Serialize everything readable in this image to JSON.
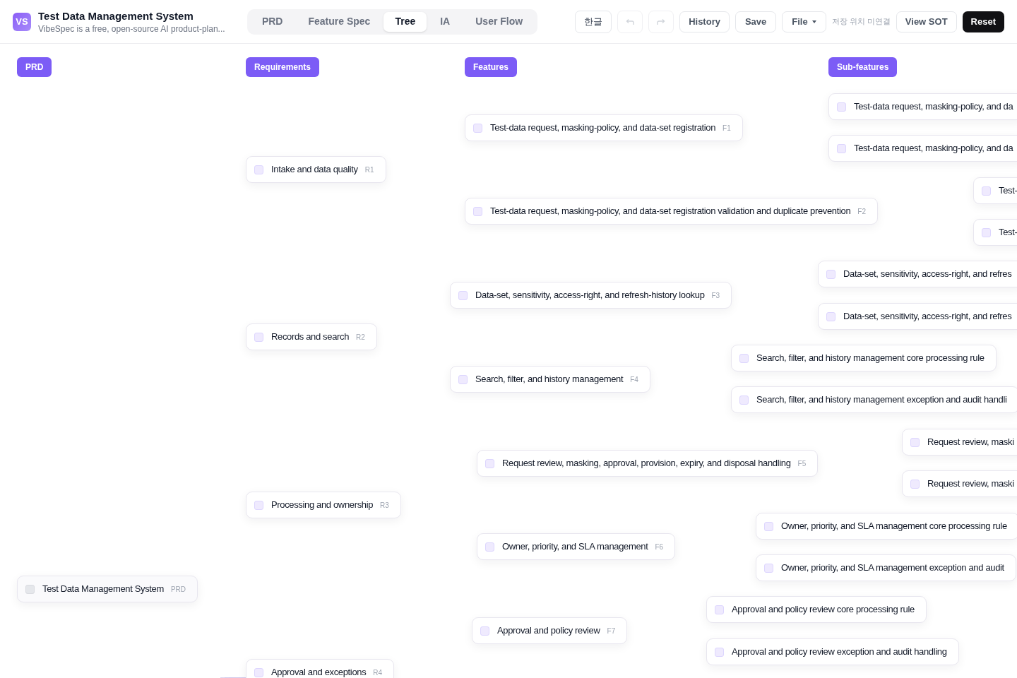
{
  "app": {
    "logo": "VS",
    "title": "Test Data Management System",
    "subtitle": "VibeSpec is a free, open-source AI product-plan..."
  },
  "tabs": [
    {
      "label": "PRD",
      "selected": false
    },
    {
      "label": "Feature Spec",
      "selected": false
    },
    {
      "label": "Tree",
      "selected": true
    },
    {
      "label": "IA",
      "selected": false
    },
    {
      "label": "User Flow",
      "selected": false
    }
  ],
  "toolbar": {
    "language": "한글",
    "undo": {
      "disabled": true
    },
    "redo": {
      "disabled": true
    },
    "history": "History",
    "save": "Save",
    "file": "File",
    "storage_status": "저장 위치 미연결",
    "view_sot": "View SOT",
    "reset": "Reset"
  },
  "columns": [
    "PRD",
    "Requirements",
    "Features",
    "Sub-features"
  ],
  "tree": {
    "label": "Test Data Management System",
    "code": "PRD",
    "kind": "root",
    "checked": false,
    "children": [
      {
        "label": "Intake and data quality",
        "code": "R1",
        "checked": false,
        "children": [
          {
            "label": "Test-data request, masking-policy, and data-set registration",
            "code": "F1",
            "checked": false,
            "children": [
              {
                "label": "Test-data request, masking-policy, and da",
                "checked": false
              },
              {
                "label": "Test-data request, masking-policy, and da",
                "checked": false
              }
            ]
          },
          {
            "label": "Test-data request, masking-policy, and data-set registration validation and duplicate prevention",
            "code": "F2",
            "checked": false,
            "children": [
              {
                "label": "Test-",
                "checked": false
              },
              {
                "label": "Test-",
                "checked": false
              }
            ]
          }
        ]
      },
      {
        "label": "Records and search",
        "code": "R2",
        "checked": false,
        "children": [
          {
            "label": "Data-set, sensitivity, access-right, and refresh-history lookup",
            "code": "F3",
            "checked": false,
            "children": [
              {
                "label": "Data-set, sensitivity, access-right, and refres",
                "checked": false
              },
              {
                "label": "Data-set, sensitivity, access-right, and refres",
                "checked": false
              }
            ]
          },
          {
            "label": "Search, filter, and history management",
            "code": "F4",
            "checked": false,
            "children": [
              {
                "label": "Search, filter, and history management core processing rule",
                "checked": false
              },
              {
                "label": "Search, filter, and history management exception and audit handli",
                "checked": false
              }
            ]
          }
        ]
      },
      {
        "label": "Processing and ownership",
        "code": "R3",
        "checked": false,
        "children": [
          {
            "label": "Request review, masking, approval, provision, expiry, and disposal handling",
            "code": "F5",
            "checked": false,
            "children": [
              {
                "label": "Request review, maski",
                "checked": false
              },
              {
                "label": "Request review, maski",
                "checked": false
              }
            ]
          },
          {
            "label": "Owner, priority, and SLA management",
            "code": "F6",
            "checked": false,
            "children": [
              {
                "label": "Owner, priority, and SLA management core processing rule",
                "checked": false
              },
              {
                "label": "Owner, priority, and SLA management exception and audit",
                "checked": false
              }
            ]
          }
        ]
      },
      {
        "label": "Approval and exceptions",
        "code": "R4",
        "checked": false,
        "children": [
          {
            "label": "Approval and policy review",
            "code": "F7",
            "checked": false,
            "children": [
              {
                "label": "Approval and policy review core processing rule",
                "checked": false
              },
              {
                "label": "Approval and policy review exception and audit handling",
                "checked": false
              }
            ]
          }
        ]
      }
    ]
  }
}
